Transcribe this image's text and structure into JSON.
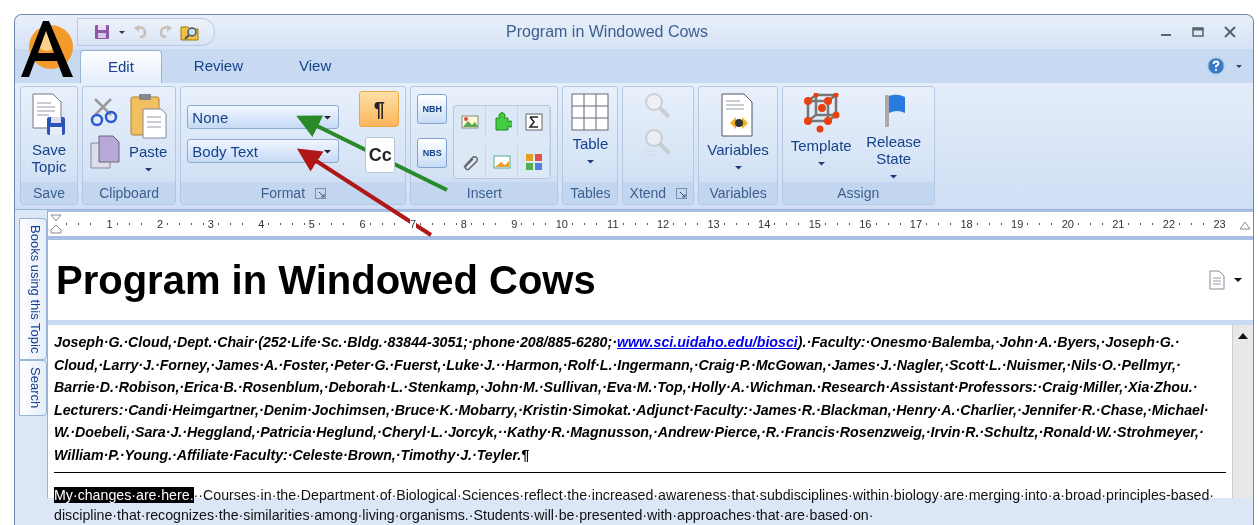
{
  "window": {
    "title": "Program in Windowed Cows"
  },
  "tabs": [
    {
      "label": "Edit",
      "selected": true
    },
    {
      "label": "Review",
      "selected": false
    },
    {
      "label": "View",
      "selected": false
    }
  ],
  "ribbon": [
    {
      "kind": "save",
      "label": "Save",
      "items": [
        {
          "label": "Save Topic",
          "dropdown": false
        }
      ]
    },
    {
      "kind": "clipboard",
      "label": "Clipboard",
      "items": [
        {
          "label": "Paste",
          "dropdown": true
        }
      ]
    },
    {
      "kind": "format",
      "label": "Format",
      "launcher": true,
      "dropdowns": [
        {
          "value": "None"
        },
        {
          "value": "Body Text"
        }
      ],
      "toggles": [
        {
          "label": "¶",
          "on": true
        },
        {
          "label": "Cc",
          "on": false
        }
      ]
    },
    {
      "kind": "insert",
      "label": "Insert",
      "items": [
        {
          "label": "NBH"
        },
        {
          "label": "NBS"
        }
      ]
    },
    {
      "kind": "tables",
      "label": "Tables",
      "items": [
        {
          "label": "Table",
          "dropdown": true
        }
      ]
    },
    {
      "kind": "xtend",
      "label": "Xtend",
      "launcher": true,
      "disabled": true
    },
    {
      "kind": "variables",
      "label": "Variables",
      "items": [
        {
          "label": "Variables",
          "dropdown": true
        }
      ]
    },
    {
      "kind": "assign",
      "label": "Assign",
      "items": [
        {
          "label": "Template",
          "dropdown": true
        },
        {
          "label": "Release State",
          "dropdown": true
        }
      ]
    }
  ],
  "ruler": {
    "marks": [
      "1",
      "2",
      "3",
      "4",
      "5",
      "6",
      "7",
      "8",
      "9",
      "10",
      "11",
      "12",
      "13",
      "14",
      "15",
      "16",
      "17",
      "18",
      "19",
      "20",
      "21",
      "22",
      "23"
    ]
  },
  "side_tabs": [
    {
      "label": "Books using this Topic"
    },
    {
      "label": "Search"
    }
  ],
  "document": {
    "heading": "Program in Windowed Cows",
    "paragraph_1": {
      "before": "Joseph·G.·Cloud,·Dept.·Chair·(252·Life·Sc.·Bldg.·83844-3051;·phone·208/885-6280;·",
      "link": "www.sci.uidaho.edu/biosci",
      "after": ").·Faculty:·Onesmo·Balemba,·John·A.·Byers,·Joseph·G.·Cloud,·Larry·J.·Forney,·James·A.·Foster,·Peter·G.·Fuerst,·Luke·J.··Harmon,·Rolf·L.·Ingermann,·Craig·P.·McGowan,·James·J.·Nagler,·Scott·L.·Nuismer,·Nils·O.·Pellmyr,·Barrie·D.·Robison,·Erica·B.·Rosenblum,·Deborah·L.·Stenkamp,·John·M.·Sullivan,·Eva·M.·Top,·Holly·A.·Wichman.·Research·Assistant·Professors:·Craig·Miller,·Xia·Zhou.·Lecturers:·Candi·Heimgartner,·Denim·Jochimsen,·Bruce·K.·Mobarry,·Kristin·Simokat.·Adjunct·Faculty:·James·R.·Blackman,·Henry·A.·Charlier,·Jennifer·R.·Chase,·Michael·W.·Doebeli,·Sara·J.·Heggland,·Patricia·Heglund,·Cheryl·L.·Jorcyk,··Kathy·R.·Magnusson,·Andrew·Pierce,·R.·Francis·Rosenzweig,·Irvin·R.·Schultz,·Ronald·W.·Strohmeyer,·William·P.·Young.·Affiliate·Faculty:·Celeste·Brown,·Timothy·J.·Teyler.¶"
    },
    "paragraph_2": {
      "selection": "My·changes·are·here.",
      "text": "··Courses·in·the·Department·of·Biological·Sciences·reflect·the·increased·awareness·that·subdisciplines·within·biology·are·merging·into·a·broad·principles-based·discipline·that·recognizes·the·similarities·among·living·organisms.·Students·will·be·presented·with·approaches·that·are·based·on·"
    }
  }
}
